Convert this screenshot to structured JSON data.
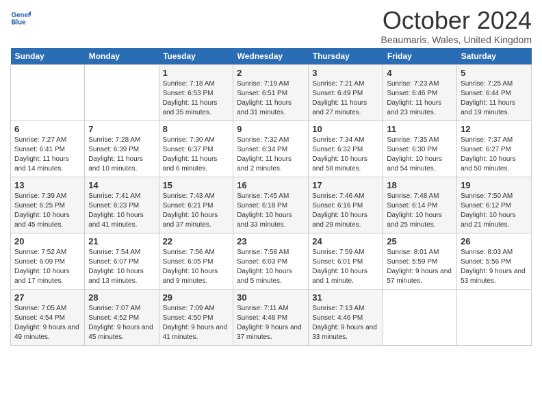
{
  "header": {
    "logo_line1": "General",
    "logo_line2": "Blue",
    "month_title": "October 2024",
    "location": "Beaumaris, Wales, United Kingdom"
  },
  "weekdays": [
    "Sunday",
    "Monday",
    "Tuesday",
    "Wednesday",
    "Thursday",
    "Friday",
    "Saturday"
  ],
  "weeks": [
    [
      {
        "day": "",
        "info": ""
      },
      {
        "day": "",
        "info": ""
      },
      {
        "day": "1",
        "info": "Sunrise: 7:18 AM\nSunset: 6:53 PM\nDaylight: 11 hours and 35 minutes."
      },
      {
        "day": "2",
        "info": "Sunrise: 7:19 AM\nSunset: 6:51 PM\nDaylight: 11 hours and 31 minutes."
      },
      {
        "day": "3",
        "info": "Sunrise: 7:21 AM\nSunset: 6:49 PM\nDaylight: 11 hours and 27 minutes."
      },
      {
        "day": "4",
        "info": "Sunrise: 7:23 AM\nSunset: 6:46 PM\nDaylight: 11 hours and 23 minutes."
      },
      {
        "day": "5",
        "info": "Sunrise: 7:25 AM\nSunset: 6:44 PM\nDaylight: 11 hours and 19 minutes."
      }
    ],
    [
      {
        "day": "6",
        "info": "Sunrise: 7:27 AM\nSunset: 6:41 PM\nDaylight: 11 hours and 14 minutes."
      },
      {
        "day": "7",
        "info": "Sunrise: 7:28 AM\nSunset: 6:39 PM\nDaylight: 11 hours and 10 minutes."
      },
      {
        "day": "8",
        "info": "Sunrise: 7:30 AM\nSunset: 6:37 PM\nDaylight: 11 hours and 6 minutes."
      },
      {
        "day": "9",
        "info": "Sunrise: 7:32 AM\nSunset: 6:34 PM\nDaylight: 11 hours and 2 minutes."
      },
      {
        "day": "10",
        "info": "Sunrise: 7:34 AM\nSunset: 6:32 PM\nDaylight: 10 hours and 58 minutes."
      },
      {
        "day": "11",
        "info": "Sunrise: 7:35 AM\nSunset: 6:30 PM\nDaylight: 10 hours and 54 minutes."
      },
      {
        "day": "12",
        "info": "Sunrise: 7:37 AM\nSunset: 6:27 PM\nDaylight: 10 hours and 50 minutes."
      }
    ],
    [
      {
        "day": "13",
        "info": "Sunrise: 7:39 AM\nSunset: 6:25 PM\nDaylight: 10 hours and 45 minutes."
      },
      {
        "day": "14",
        "info": "Sunrise: 7:41 AM\nSunset: 6:23 PM\nDaylight: 10 hours and 41 minutes."
      },
      {
        "day": "15",
        "info": "Sunrise: 7:43 AM\nSunset: 6:21 PM\nDaylight: 10 hours and 37 minutes."
      },
      {
        "day": "16",
        "info": "Sunrise: 7:45 AM\nSunset: 6:18 PM\nDaylight: 10 hours and 33 minutes."
      },
      {
        "day": "17",
        "info": "Sunrise: 7:46 AM\nSunset: 6:16 PM\nDaylight: 10 hours and 29 minutes."
      },
      {
        "day": "18",
        "info": "Sunrise: 7:48 AM\nSunset: 6:14 PM\nDaylight: 10 hours and 25 minutes."
      },
      {
        "day": "19",
        "info": "Sunrise: 7:50 AM\nSunset: 6:12 PM\nDaylight: 10 hours and 21 minutes."
      }
    ],
    [
      {
        "day": "20",
        "info": "Sunrise: 7:52 AM\nSunset: 6:09 PM\nDaylight: 10 hours and 17 minutes."
      },
      {
        "day": "21",
        "info": "Sunrise: 7:54 AM\nSunset: 6:07 PM\nDaylight: 10 hours and 13 minutes."
      },
      {
        "day": "22",
        "info": "Sunrise: 7:56 AM\nSunset: 6:05 PM\nDaylight: 10 hours and 9 minutes."
      },
      {
        "day": "23",
        "info": "Sunrise: 7:58 AM\nSunset: 6:03 PM\nDaylight: 10 hours and 5 minutes."
      },
      {
        "day": "24",
        "info": "Sunrise: 7:59 AM\nSunset: 6:01 PM\nDaylight: 10 hours and 1 minute."
      },
      {
        "day": "25",
        "info": "Sunrise: 8:01 AM\nSunset: 5:59 PM\nDaylight: 9 hours and 57 minutes."
      },
      {
        "day": "26",
        "info": "Sunrise: 8:03 AM\nSunset: 5:56 PM\nDaylight: 9 hours and 53 minutes."
      }
    ],
    [
      {
        "day": "27",
        "info": "Sunrise: 7:05 AM\nSunset: 4:54 PM\nDaylight: 9 hours and 49 minutes."
      },
      {
        "day": "28",
        "info": "Sunrise: 7:07 AM\nSunset: 4:52 PM\nDaylight: 9 hours and 45 minutes."
      },
      {
        "day": "29",
        "info": "Sunrise: 7:09 AM\nSunset: 4:50 PM\nDaylight: 9 hours and 41 minutes."
      },
      {
        "day": "30",
        "info": "Sunrise: 7:11 AM\nSunset: 4:48 PM\nDaylight: 9 hours and 37 minutes."
      },
      {
        "day": "31",
        "info": "Sunrise: 7:13 AM\nSunset: 4:46 PM\nDaylight: 9 hours and 33 minutes."
      },
      {
        "day": "",
        "info": ""
      },
      {
        "day": "",
        "info": ""
      }
    ]
  ]
}
